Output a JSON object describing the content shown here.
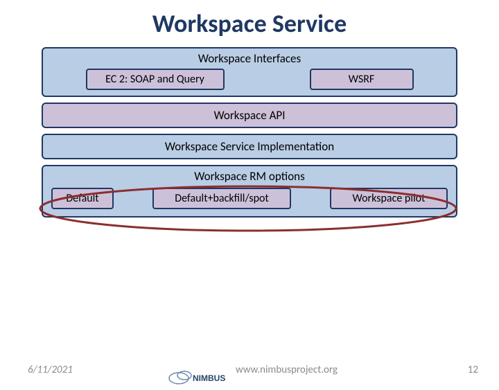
{
  "title": "Workspace Service",
  "layers": {
    "interfaces": {
      "title": "Workspace Interfaces",
      "ec2": "EC 2: SOAP and Query",
      "wsrf": "WSRF"
    },
    "api": "Workspace API",
    "impl": "Workspace Service Implementation",
    "rm": {
      "title": "Workspace RM options",
      "default": "Default",
      "backfill": "Default+backfill/spot",
      "pilot": "Workspace pilot"
    }
  },
  "annotation": {
    "circle_target": "rm-options-row",
    "circle_color": "#8b2e2e"
  },
  "footer": {
    "date": "6/11/2021",
    "logo_text": "NIMBUS",
    "url": "www.nimbusproject.org",
    "page_number": "12"
  }
}
